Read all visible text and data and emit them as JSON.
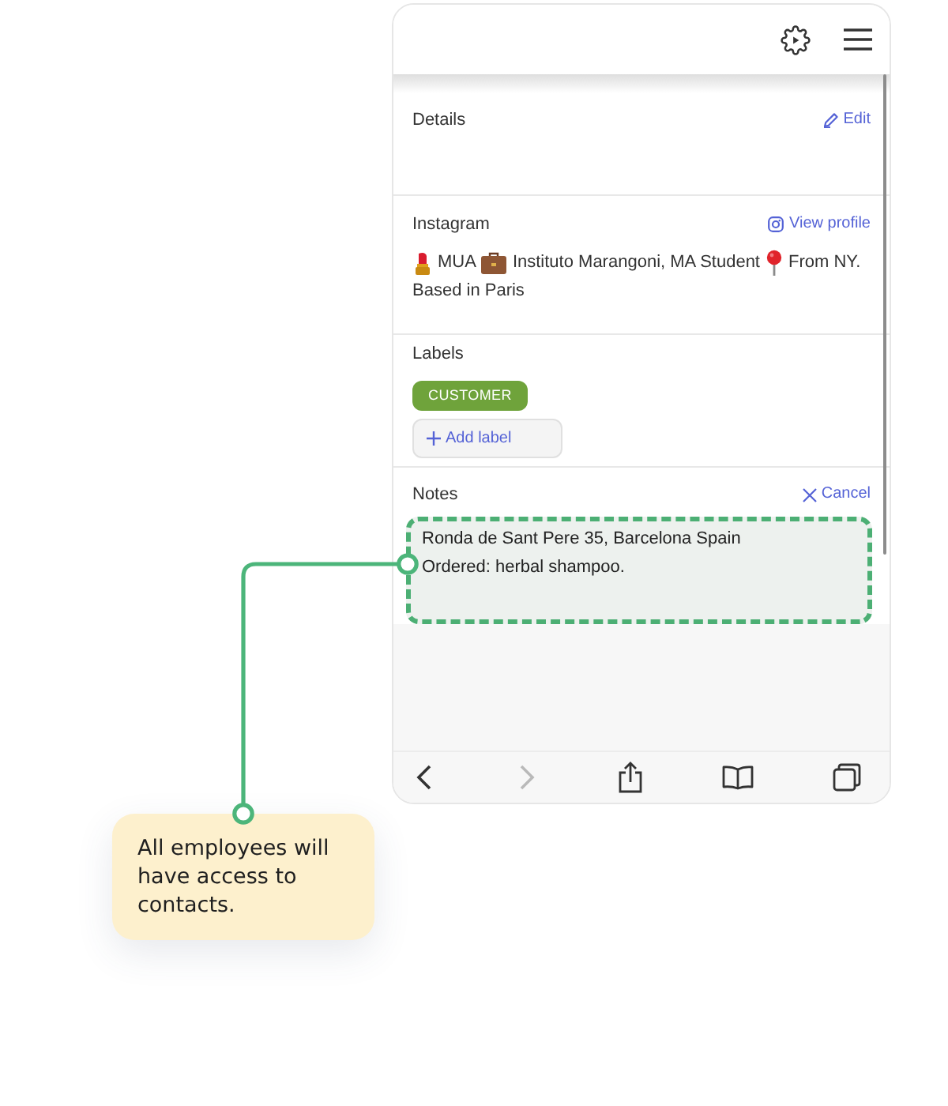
{
  "sections": [
    {
      "kind": "details",
      "title": "Details",
      "action": "Edit"
    },
    {
      "kind": "instagram",
      "title": "Instagram",
      "action": "View profile",
      "bio": [
        "MUA",
        "Instituto Marangoni, MA Student",
        "From NY.",
        "Based in Paris"
      ]
    },
    {
      "kind": "labels",
      "title": "Labels",
      "labels": [
        {
          "text": "CUSTOMER",
          "color": "#6fa33b"
        }
      ],
      "add_button": "Add label"
    },
    {
      "kind": "notes",
      "title": "Notes",
      "action": "Cancel",
      "value": "Ronda de Sant Pere 35, Barcelona Spain\nOrdered: herbal shampoo."
    }
  ],
  "browser_toolbar": [
    {
      "kind": "back",
      "disabled": false
    },
    {
      "kind": "forward",
      "disabled": true
    },
    {
      "kind": "share",
      "disabled": false
    },
    {
      "kind": "bookmarks",
      "disabled": false
    },
    {
      "kind": "tabs",
      "disabled": false
    }
  ],
  "callout": {
    "text": "All employees will have access to contacts."
  }
}
